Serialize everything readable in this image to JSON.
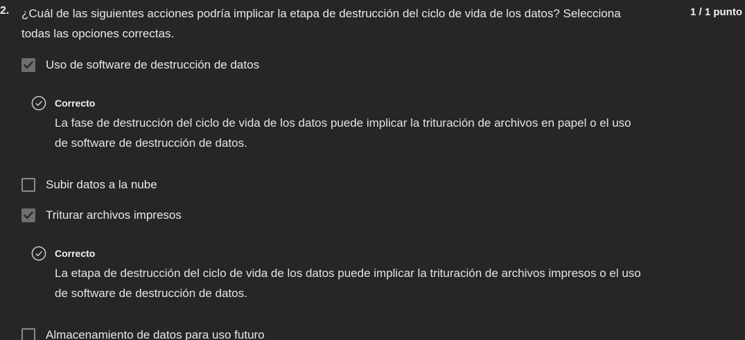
{
  "question": {
    "number": "2.",
    "text": "¿Cuál de las siguientes acciones podría implicar la etapa de destrucción del ciclo de vida de los datos? Selecciona todas las opciones correctas.",
    "score": "1 / 1 punto"
  },
  "options": [
    {
      "label": "Uso de software de destrucción de datos",
      "checked": true
    },
    {
      "label": "Subir datos a la nube",
      "checked": false
    },
    {
      "label": "Triturar archivos impresos",
      "checked": true
    },
    {
      "label": "Almacenamiento de datos para uso futuro",
      "checked": false
    }
  ],
  "feedback": [
    {
      "icon": "check-circle-icon",
      "title": "Correcto",
      "text": "La fase de destrucción del ciclo de vida de los datos puede implicar la trituración de archivos en papel o el uso de software de destrucción de datos."
    },
    {
      "icon": "check-circle-icon",
      "title": "Correcto",
      "text": "La etapa de destrucción del ciclo de vida de los datos puede implicar la trituración de archivos impresos o el uso de software de destrucción de datos."
    }
  ],
  "colors": {
    "background": "#262626",
    "text": "#e8e8e8",
    "checkbox_checked": "#6e6e6e",
    "checkbox_border": "#8c8c8c"
  }
}
